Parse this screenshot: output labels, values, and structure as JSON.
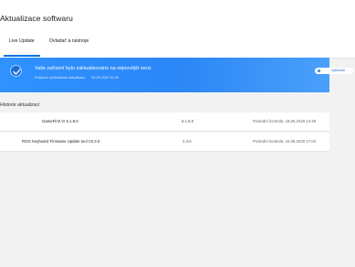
{
  "window": {
    "title": "Aktualizace softwaru"
  },
  "tabs": [
    {
      "label": "Live Update",
      "active": true
    },
    {
      "label": "Ovladač a nástroje",
      "active": false
    }
  ],
  "banner": {
    "icon": "check-circle-icon",
    "message": "Vaše zařízení bylo zaktualizováno na nejnovější verzi.",
    "last_check_label": "Poslední vyhledávání aktualizací",
    "last_check_value": "22.05.2020 20:28",
    "button_label": "Vyhledat",
    "color_start": "#2f92ff",
    "color_end": "#4aa0fb"
  },
  "history": {
    "title": "Historie aktualizací",
    "rows": [
      {
        "name": "GameFirst VI 6.1.8.0",
        "version": "6.1.8.0",
        "last_check": "Poslední kontrola: 18.05.2020 13:49"
      },
      {
        "name": "ROG Keyboard Firmware Update tool V2.3.0",
        "version": "2.3.0",
        "last_check": "Poslední kontrola: 15.05.2020 17:04"
      }
    ]
  },
  "colors": {
    "accent": "#0b74e6",
    "background": "#f2f2f2"
  }
}
